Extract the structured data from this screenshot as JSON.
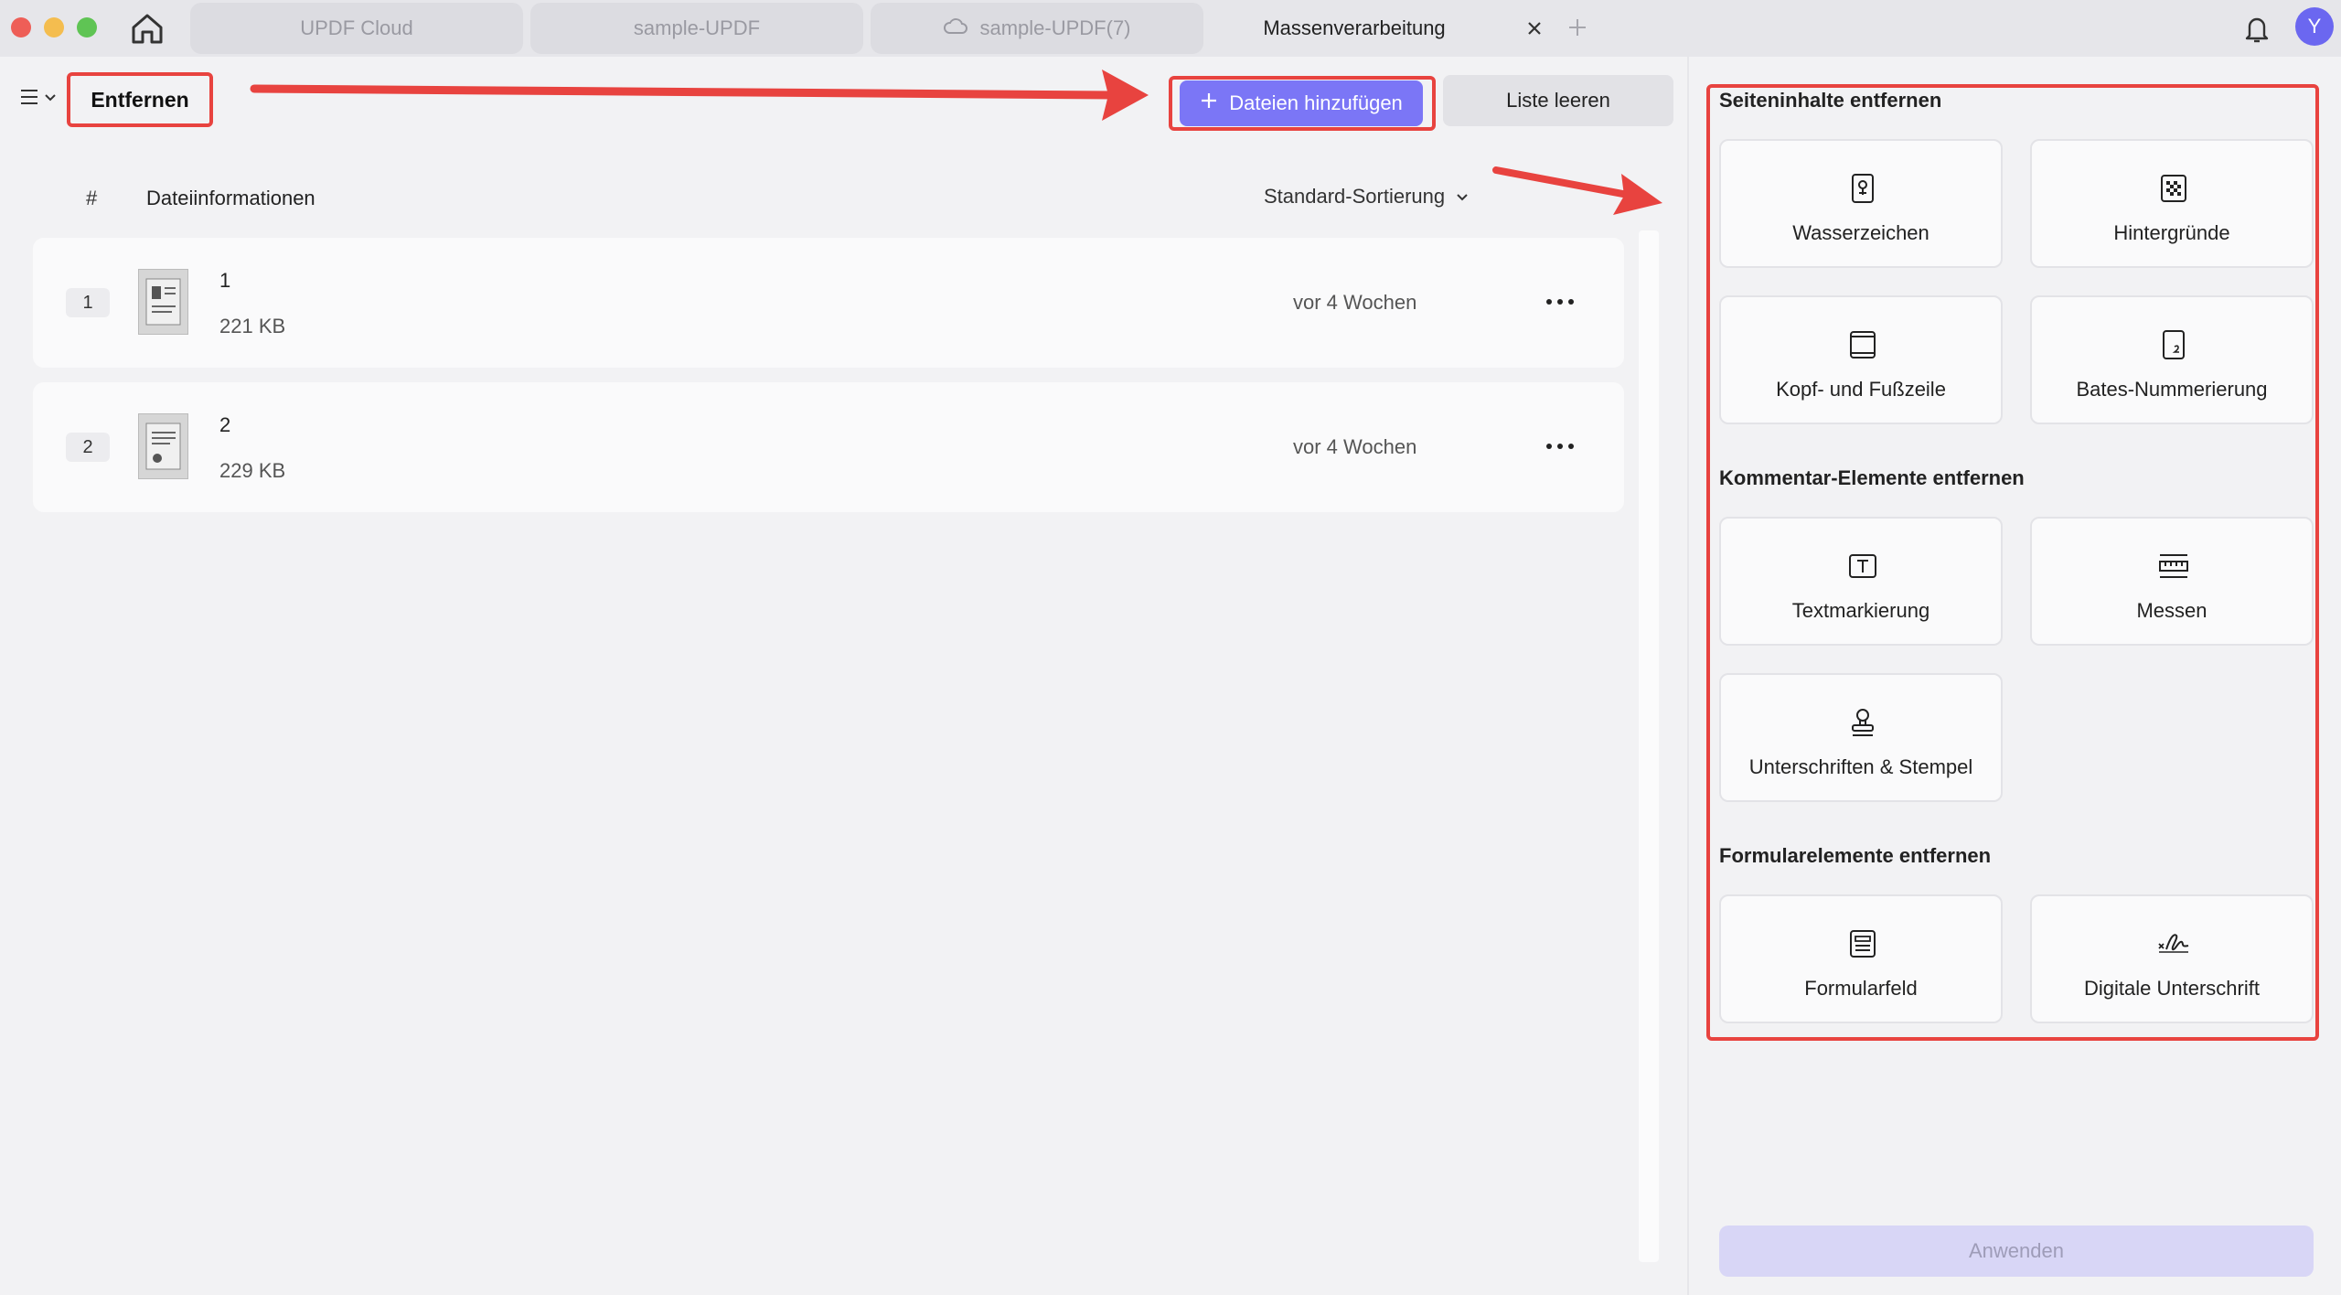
{
  "tabs": [
    {
      "label": "UPDF Cloud"
    },
    {
      "label": "sample-UPDF"
    },
    {
      "label": "sample-UPDF(7)"
    },
    {
      "label": "Massenverarbeitung"
    }
  ],
  "user": {
    "initial": "Y"
  },
  "toolbar": {
    "mode_label": "Entfernen",
    "add_files_label": "Dateien hinzufügen",
    "clear_list_label": "Liste leeren"
  },
  "list": {
    "col_number": "#",
    "col_info": "Dateiinformationen",
    "sort_label": "Standard-Sortierung",
    "files": [
      {
        "index": "1",
        "name": "1",
        "size": "221 KB",
        "date": "vor 4 Wochen"
      },
      {
        "index": "2",
        "name": "2",
        "size": "229 KB",
        "date": "vor 4 Wochen"
      }
    ]
  },
  "panel": {
    "sections": [
      {
        "title": "Seiteninhalte entfernen",
        "items": [
          {
            "label": "Wasserzeichen",
            "icon": "watermark-icon"
          },
          {
            "label": "Hintergründe",
            "icon": "background-icon"
          },
          {
            "label": "Kopf- und Fußzeile",
            "icon": "header-footer-icon"
          },
          {
            "label": "Bates-Nummerierung",
            "icon": "bates-icon"
          }
        ]
      },
      {
        "title": "Kommentar-Elemente entfernen",
        "items": [
          {
            "label": "Textmarkierung",
            "icon": "text-markup-icon"
          },
          {
            "label": "Messen",
            "icon": "measure-icon"
          },
          {
            "label": "Unterschriften & Stempel",
            "icon": "stamp-icon"
          }
        ]
      },
      {
        "title": "Formularelemente entfernen",
        "items": [
          {
            "label": "Formularfeld",
            "icon": "form-field-icon"
          },
          {
            "label": "Digitale Unterschrift",
            "icon": "digital-signature-icon"
          }
        ]
      }
    ],
    "apply_label": "Anwenden"
  },
  "colors": {
    "accent": "#7b76f6",
    "annotation_red": "#e8433f",
    "avatar": "#6b67f0"
  }
}
